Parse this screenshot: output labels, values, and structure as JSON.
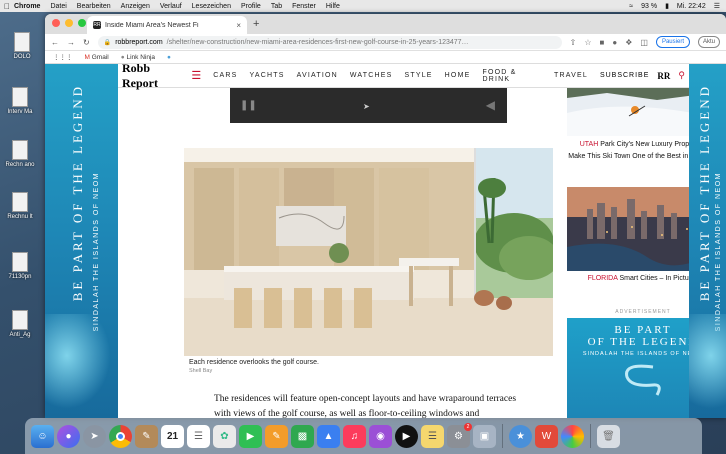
{
  "menubar": {
    "app": "Chrome",
    "items": [
      "Datei",
      "Bearbeiten",
      "Anzeigen",
      "Verlauf",
      "Lesezeichen",
      "Profile",
      "Tab",
      "Fenster",
      "Hilfe"
    ],
    "battery": "93 %",
    "clock": "Mi. 22:42"
  },
  "desktop": {
    "items": [
      "DOLO",
      "Interv Ma",
      "Rechn ano",
      "Rechnu lt",
      "71130pn",
      "Anti_Ag"
    ]
  },
  "browser": {
    "tab_title": "Inside Miami Area's Newest Fi",
    "tab_favicon": "RR",
    "url_domain": "robbreport.com",
    "url_path": "/shelter/new-construction/new-miami-area-residences-first-new-golf-course-in-25-years-123477…",
    "pause_label": "Pausiert",
    "update_label": "Aktu",
    "bookmarks": [
      "Gmail",
      "Link Ninja"
    ]
  },
  "site": {
    "logo": "Robb Report",
    "nav": [
      "CARS",
      "YACHTS",
      "AVIATION",
      "WATCHES",
      "STYLE",
      "HOME",
      "FOOD & DRINK",
      "TRAVEL"
    ],
    "subscribe": "SUBSCRIBE",
    "rr": "RR"
  },
  "article": {
    "caption": "Each residence overlooks the golf course.",
    "credit": "Shell Bay",
    "body": "The residences will feature open-concept layouts and have wraparound terraces with views of the golf course, as well as floor-to-ceiling windows and"
  },
  "sidebar": {
    "story1_tag": "UTAH",
    "story1_line1": "Park City's New Luxury Properties",
    "story1_line2": "Make This Ski Town One of the Best in the West",
    "story2_tag": "FLORIDA",
    "story2_title": "Smart Cities – In Pictures",
    "ad_label": "ADVERTISEMENT",
    "ad_line1": "BE PART",
    "ad_line2": "OF THE LEGEND",
    "ad_line3": "SINDALAH  THE ISLANDS OF NEOM"
  },
  "side_ads": {
    "headline": "BE PART OF THE LEGEND",
    "sub": "SINDALAH  THE ISLANDS OF NEOM"
  },
  "dock": {
    "icons": [
      "finder-icon",
      "siri-icon",
      "launchpad-icon",
      "chrome-icon",
      "notes-icon",
      "calendar-icon",
      "reminders-icon",
      "photos-icon",
      "facetime-icon",
      "pages-icon",
      "numbers-icon",
      "keynote-icon",
      "music-icon",
      "podcasts-icon",
      "tv-icon",
      "stickies-icon",
      "system-preferences-icon",
      "preview-icon",
      "network-icon",
      "word-icon",
      "photos-app-icon",
      "trash-icon"
    ],
    "calendar_day": "21",
    "settings_badge": "2"
  }
}
